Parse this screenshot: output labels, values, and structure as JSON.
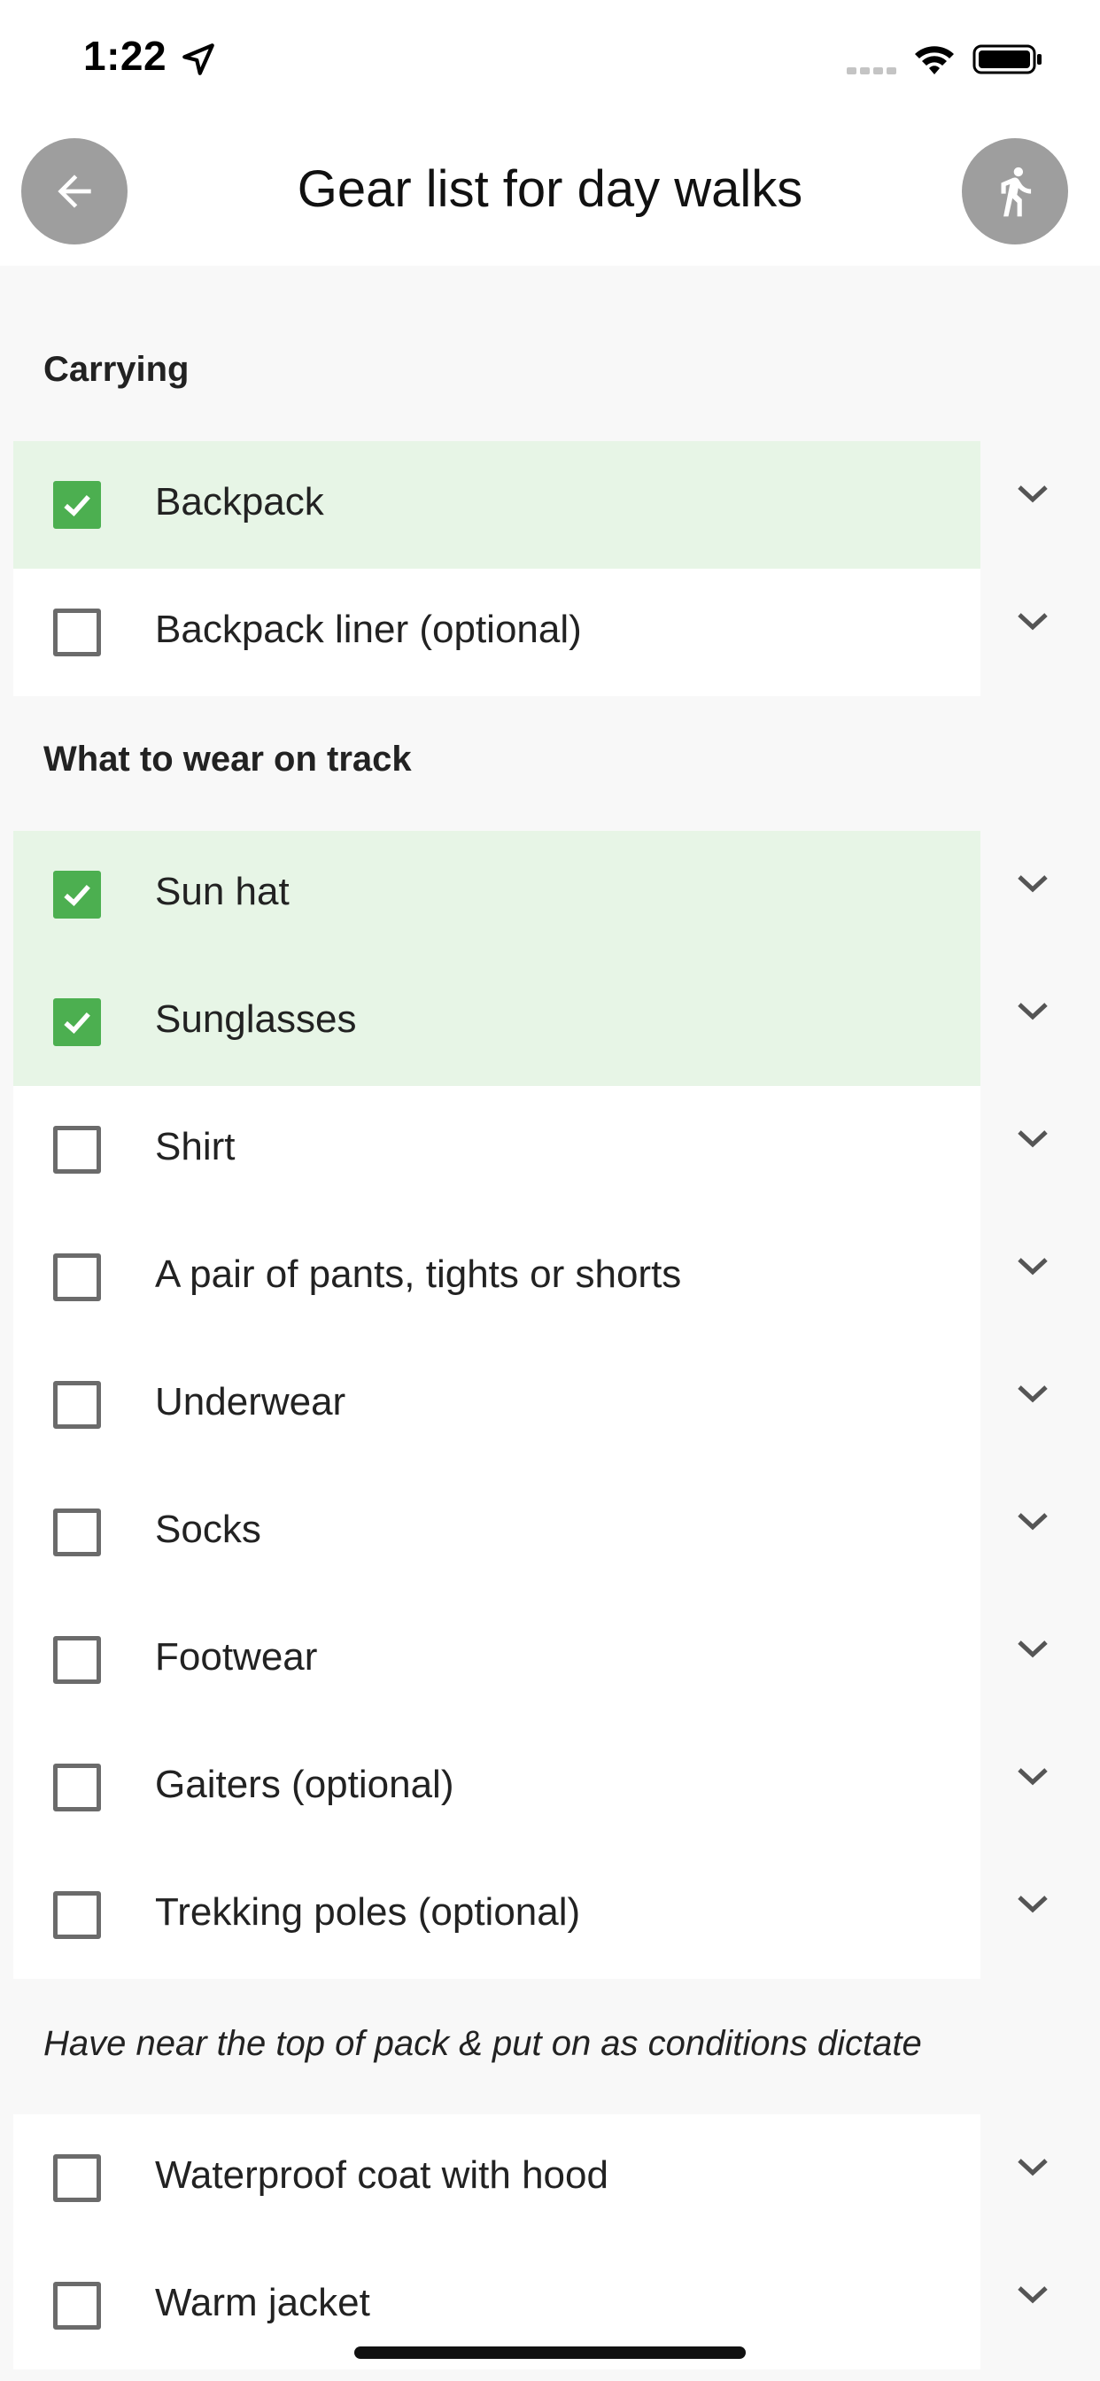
{
  "status_bar": {
    "time": "1:22",
    "icons": [
      "location-arrow-icon",
      "cellular-signal-icon",
      "wifi-icon",
      "battery-icon"
    ]
  },
  "header": {
    "title": "Gear list for day walks",
    "back_icon": "arrow-left-icon",
    "walk_icon": "walking-person-icon"
  },
  "colors": {
    "checked_bg": "#e7f5e6",
    "checkbox_checked": "#4caf50",
    "button_grey": "#9e9e9e"
  },
  "sections": [
    {
      "title": "Carrying",
      "items": [
        {
          "label": "Backpack",
          "checked": true
        },
        {
          "label": "Backpack liner (optional)",
          "checked": false
        }
      ]
    },
    {
      "title": "What to wear on track",
      "items": [
        {
          "label": "Sun hat",
          "checked": true
        },
        {
          "label": "Sunglasses",
          "checked": true
        },
        {
          "label": "Shirt",
          "checked": false
        },
        {
          "label": "A pair of pants, tights or shorts",
          "checked": false
        },
        {
          "label": "Underwear",
          "checked": false
        },
        {
          "label": "Socks",
          "checked": false
        },
        {
          "label": "Footwear",
          "checked": false
        },
        {
          "label": "Gaiters (optional)",
          "checked": false
        },
        {
          "label": "Trekking poles (optional)",
          "checked": false
        }
      ]
    },
    {
      "note": "Have near the top of pack & put on as conditions dictate",
      "items": [
        {
          "label": "Waterproof coat with hood",
          "checked": false
        },
        {
          "label": "Warm jacket",
          "checked": false
        }
      ]
    }
  ]
}
